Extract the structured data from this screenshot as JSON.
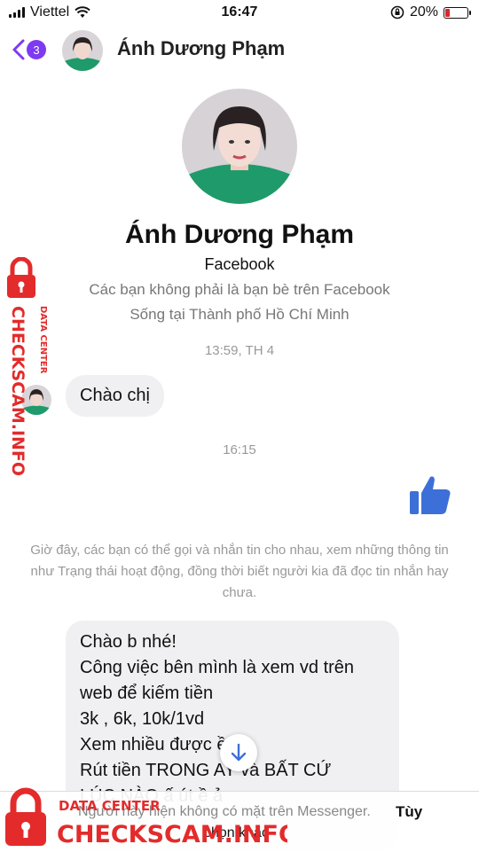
{
  "status_bar": {
    "carrier": "Viettel",
    "time": "16:47",
    "battery_percent": "20%",
    "battery_level": 0.2,
    "battery_color": "#e0242b"
  },
  "header": {
    "back_badge": "3",
    "contact_name": "Ánh Dương Phạm",
    "accent": "#7e3af2"
  },
  "profile": {
    "name": "Ánh Dương Phạm",
    "platform": "Facebook",
    "friend_status": "Các bạn không phải là bạn bè trên Facebook",
    "location": "Sống tại Thành phố Hồ Chí Minh"
  },
  "messages": {
    "time_1": "13:59, TH 4",
    "greeting": "Chào chị",
    "time_2": "16:15",
    "notice": "Giờ đây, các bạn có thể gọi và nhắn tin cho nhau, xem những thông tin như Trạng thái hoạt động, đồng thời biết người kia đã đọc tin nhắn hay chưa.",
    "long_lines": [
      "Chào b nhé!",
      "Công việc bên mình là xem vd trên",
      "web để kiếm tiền",
      "3k , 6k, 10k/1vd",
      "Xem nhiều được    ều",
      "Rút tiền TRONG    AY và BẤT CỨ",
      "LÚC NÀO   ấ    út    ề     ả    "
    ]
  },
  "footer": {
    "notice": "Người này hiện không có mặt trên Messenger.",
    "link": "Tùy",
    "link_cont": "chọn khác"
  },
  "watermark": {
    "side_small": "DATA CENTER",
    "side_big": "CHECKSCAM.INFO",
    "bottom_small": "DATA CENTER",
    "bottom_big": "CHECKSCAM.INFO",
    "color": "#e32b2b"
  }
}
